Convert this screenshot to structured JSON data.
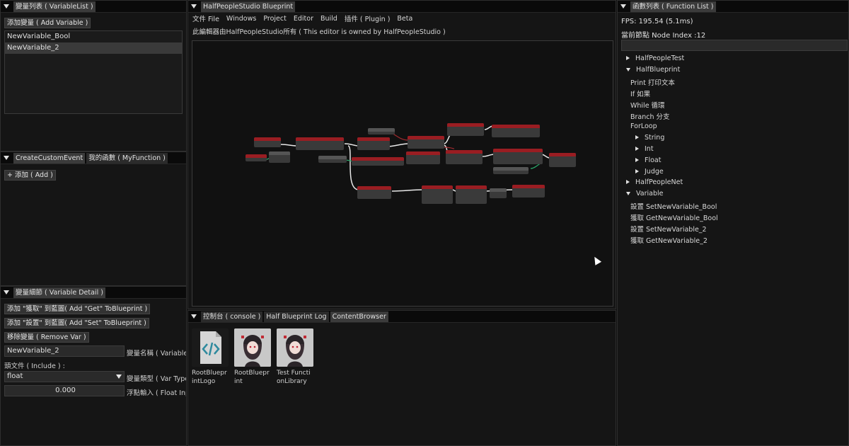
{
  "variable_panel": {
    "title": "變量列表 ( VariableList )",
    "add_button": "添加變量 ( Add Variable )",
    "items": [
      "NewVariable_Bool",
      "NewVariable_2"
    ]
  },
  "event_panel": {
    "tabs": [
      "CreateCustomEvent",
      "我的函數 ( MyFunction )"
    ],
    "add_button": "+ 添加 ( Add )"
  },
  "detail_panel": {
    "title": "變量細節 ( Variable Detail )",
    "add_get_button": "添加 \"獲取\" 到藍圖( Add \"Get\" ToBlueprint )",
    "add_set_button": "添加 \"設置\" 到藍圖( Add \"Set\" ToBlueprint )",
    "remove_button": "移除變量 ( Remove Var )",
    "name_value": "NewVariable_2",
    "name_label": "變量名稱 ( Variable",
    "include_label": "頭文件 ( Include ) :",
    "type_value": "float",
    "type_label": "變量類型 ( Var Type",
    "float_value": "0.000",
    "float_label": "浮點輸入 ( Float Inp"
  },
  "blueprint": {
    "tab": "HalfPeopleStudio Blueprint",
    "menu": [
      "文件 File",
      "Windows",
      "Project",
      "Editor",
      "Build",
      "插件 ( Plugin )",
      "Beta"
    ],
    "owner_note": "此編輯器由HalfPeopleStudio所有 ( This editor is owned by HalfPeopleStudio )"
  },
  "console": {
    "tabs": [
      "控制台 ( console )",
      "Half Blueprint Log",
      "ContentBrowser"
    ],
    "assets": [
      "RootBlueprintLogo",
      "RootBlueprint",
      "Test FunctionLibrary"
    ]
  },
  "function_panel": {
    "title": "函數列表 ( Function List )",
    "fps": "FPS: 195.54 (5.1ms)",
    "node_index": "當前節點 Node Index :12",
    "tree": [
      {
        "label": "HalfPeopleTest",
        "kind": "collapsed"
      },
      {
        "label": "HalfBlueprint",
        "kind": "expanded"
      },
      {
        "label": "Print   打印文本",
        "kind": "leaf"
      },
      {
        "label": "If      如果",
        "kind": "leaf"
      },
      {
        "label": "While   循環",
        "kind": "leaf"
      },
      {
        "label": "Branch  分支",
        "kind": "leaf"
      },
      {
        "label": "ForLoop",
        "kind": "leaf"
      },
      {
        "label": "String",
        "kind": "collapsed"
      },
      {
        "label": "Int",
        "kind": "collapsed"
      },
      {
        "label": "Float",
        "kind": "collapsed"
      },
      {
        "label": "Judge",
        "kind": "collapsed"
      },
      {
        "label": "HalfPeopleNet",
        "kind": "collapsed"
      },
      {
        "label": "Variable",
        "kind": "expanded"
      },
      {
        "label": "設置 SetNewVariable_Bool",
        "kind": "leaf"
      },
      {
        "label": "獲取 GetNewVariable_Bool",
        "kind": "leaf"
      },
      {
        "label": "設置 SetNewVariable_2",
        "kind": "leaf"
      },
      {
        "label": "獲取 GetNewVariable_2",
        "kind": "leaf"
      }
    ]
  }
}
